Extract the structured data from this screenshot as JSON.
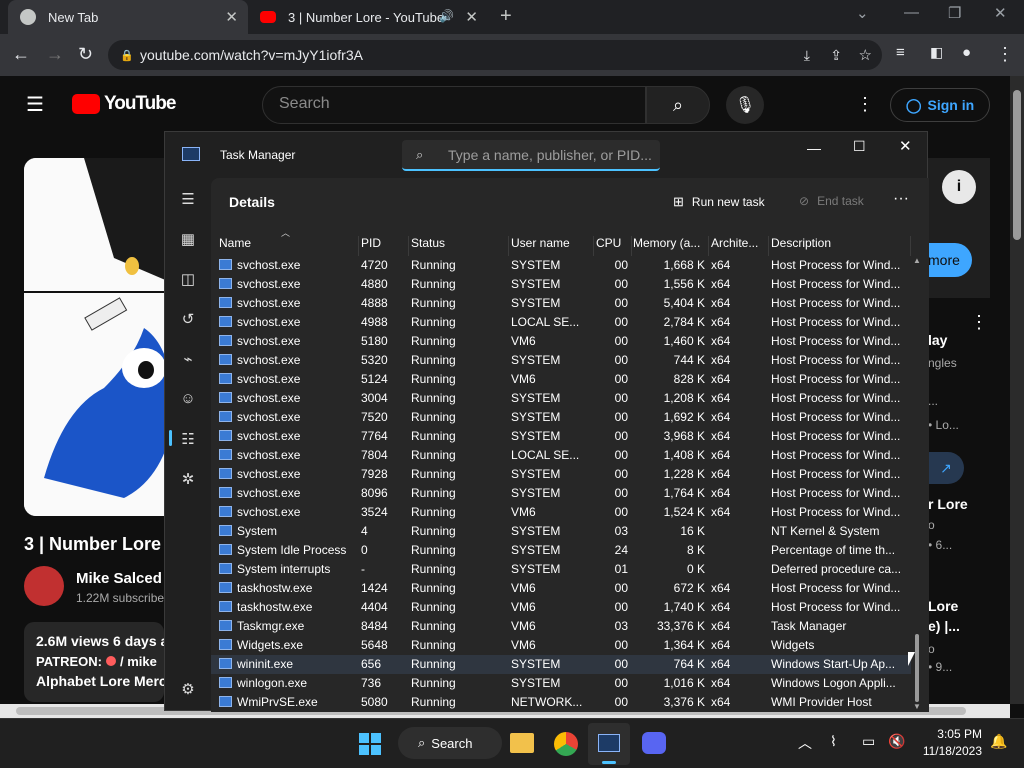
{
  "browser": {
    "tabs": [
      {
        "label": "New Tab",
        "close": "✕"
      },
      {
        "label": "3 | Number Lore - YouTube",
        "close": "✕"
      }
    ],
    "new_tab": "+",
    "url": "youtube.com/watch?v=mJyY1iofr3A"
  },
  "youtube": {
    "logo": "YouTube",
    "search_placeholder": "Search",
    "sign_in": "Sign in",
    "video_title": "3 | Number Lore",
    "channel": "Mike Salced",
    "subscribers": "1.22M subscribe",
    "views": "2.6M views  6 days a",
    "patreon": "PATREON:",
    "patreon_link": "/ mike",
    "merch": "Alphabet Lore Merch",
    "more": "more",
    "side_texts": [
      "lay",
      "ngles",
      "...",
      "• Lo...",
      "r Lore",
      "o",
      "• 6...",
      "Lore",
      "e) |...",
      "o",
      "• 9..."
    ]
  },
  "task_manager": {
    "title": "Task Manager",
    "search_placeholder": "Type a name, publisher, or PID...",
    "page": "Details",
    "run_new_task": "Run new task",
    "end_task": "End task",
    "columns": [
      "Name",
      "PID",
      "Status",
      "User name",
      "CPU",
      "Memory (a...",
      "Archite...",
      "Description"
    ],
    "rows": [
      [
        "svchost.exe",
        "4720",
        "Running",
        "SYSTEM",
        "00",
        "1,668 K",
        "x64",
        "Host Process for Wind..."
      ],
      [
        "svchost.exe",
        "4880",
        "Running",
        "SYSTEM",
        "00",
        "1,556 K",
        "x64",
        "Host Process for Wind..."
      ],
      [
        "svchost.exe",
        "4888",
        "Running",
        "SYSTEM",
        "00",
        "5,404 K",
        "x64",
        "Host Process for Wind..."
      ],
      [
        "svchost.exe",
        "4988",
        "Running",
        "LOCAL SE...",
        "00",
        "2,784 K",
        "x64",
        "Host Process for Wind..."
      ],
      [
        "svchost.exe",
        "5180",
        "Running",
        "VM6",
        "00",
        "1,460 K",
        "x64",
        "Host Process for Wind..."
      ],
      [
        "svchost.exe",
        "5320",
        "Running",
        "SYSTEM",
        "00",
        "744 K",
        "x64",
        "Host Process for Wind..."
      ],
      [
        "svchost.exe",
        "5124",
        "Running",
        "VM6",
        "00",
        "828 K",
        "x64",
        "Host Process for Wind..."
      ],
      [
        "svchost.exe",
        "3004",
        "Running",
        "SYSTEM",
        "00",
        "1,208 K",
        "x64",
        "Host Process for Wind..."
      ],
      [
        "svchost.exe",
        "7520",
        "Running",
        "SYSTEM",
        "00",
        "1,692 K",
        "x64",
        "Host Process for Wind..."
      ],
      [
        "svchost.exe",
        "7764",
        "Running",
        "SYSTEM",
        "00",
        "3,968 K",
        "x64",
        "Host Process for Wind..."
      ],
      [
        "svchost.exe",
        "7804",
        "Running",
        "LOCAL SE...",
        "00",
        "1,408 K",
        "x64",
        "Host Process for Wind..."
      ],
      [
        "svchost.exe",
        "7928",
        "Running",
        "SYSTEM",
        "00",
        "1,228 K",
        "x64",
        "Host Process for Wind..."
      ],
      [
        "svchost.exe",
        "8096",
        "Running",
        "SYSTEM",
        "00",
        "1,764 K",
        "x64",
        "Host Process for Wind..."
      ],
      [
        "svchost.exe",
        "3524",
        "Running",
        "VM6",
        "00",
        "1,524 K",
        "x64",
        "Host Process for Wind..."
      ],
      [
        "System",
        "4",
        "Running",
        "SYSTEM",
        "03",
        "16 K",
        "",
        "NT Kernel & System"
      ],
      [
        "System Idle Process",
        "0",
        "Running",
        "SYSTEM",
        "24",
        "8 K",
        "",
        "Percentage of time th..."
      ],
      [
        "System interrupts",
        "-",
        "Running",
        "SYSTEM",
        "01",
        "0 K",
        "",
        "Deferred procedure ca..."
      ],
      [
        "taskhostw.exe",
        "1424",
        "Running",
        "VM6",
        "00",
        "672 K",
        "x64",
        "Host Process for Wind..."
      ],
      [
        "taskhostw.exe",
        "4404",
        "Running",
        "VM6",
        "00",
        "1,740 K",
        "x64",
        "Host Process for Wind..."
      ],
      [
        "Taskmgr.exe",
        "8484",
        "Running",
        "VM6",
        "03",
        "33,376 K",
        "x64",
        "Task Manager"
      ],
      [
        "Widgets.exe",
        "5648",
        "Running",
        "VM6",
        "00",
        "1,364 K",
        "x64",
        "Widgets"
      ],
      [
        "wininit.exe",
        "656",
        "Running",
        "SYSTEM",
        "00",
        "764 K",
        "x64",
        "Windows Start-Up Ap..."
      ],
      [
        "winlogon.exe",
        "736",
        "Running",
        "SYSTEM",
        "00",
        "1,016 K",
        "x64",
        "Windows Logon Appli..."
      ],
      [
        "WmiPrvSE.exe",
        "5080",
        "Running",
        "NETWORK...",
        "00",
        "3,376 K",
        "x64",
        "WMI Provider Host"
      ]
    ],
    "selected_row": 21
  },
  "taskbar": {
    "search": "Search",
    "time": "3:05 PM",
    "date": "11/18/2023"
  }
}
